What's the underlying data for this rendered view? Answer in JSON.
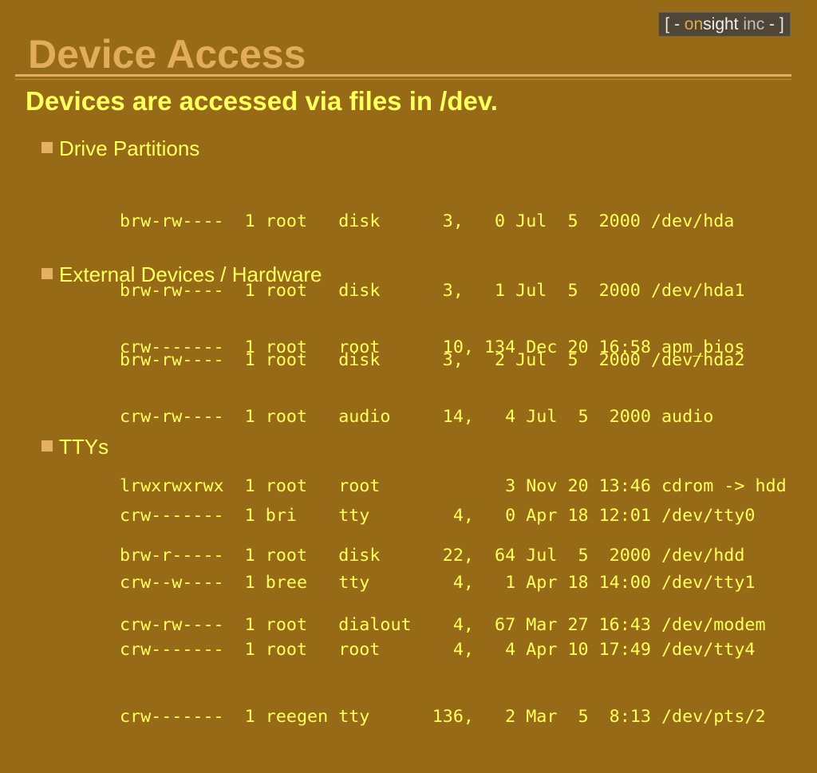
{
  "logo": {
    "open_bracket": "[ - ",
    "on": "on",
    "sight": "sight",
    "inc": " inc",
    "close_bracket": " - ]"
  },
  "slide": {
    "title": "Device Access",
    "subtitle": "Devices are accessed via files in /dev."
  },
  "sections": [
    {
      "label": "Drive Partitions",
      "lines": [
        "brw-rw----  1 root   disk      3,   0 Jul  5  2000 /dev/hda",
        "brw-rw----  1 root   disk      3,   1 Jul  5  2000 /dev/hda1",
        "brw-rw----  1 root   disk      3,   2 Jul  5  2000 /dev/hda2"
      ]
    },
    {
      "label": "External Devices / Hardware",
      "lines": [
        "crw-------  1 root   root      10, 134 Dec 20 16:58 apm_bios",
        "crw-rw----  1 root   audio     14,   4 Jul  5  2000 audio",
        "lrwxrwxrwx  1 root   root            3 Nov 20 13:46 cdrom -> hdd",
        "brw-r-----  1 root   disk      22,  64 Jul  5  2000 /dev/hdd",
        "crw-rw----  1 root   dialout    4,  67 Mar 27 16:43 /dev/modem"
      ]
    },
    {
      "label": "TTYs",
      "lines": [
        "crw-------  1 bri    tty        4,   0 Apr 18 12:01 /dev/tty0",
        "crw--w----  1 bree   tty        4,   1 Apr 18 14:00 /dev/tty1",
        "crw-------  1 root   root       4,   4 Apr 10 17:49 /dev/tty4",
        "crw-------  1 reegen tty      136,   2 Mar  5  8:13 /dev/pts/2"
      ]
    }
  ],
  "colors": {
    "background": "#966a16",
    "title": "#e2ad5b",
    "text": "#ffff5e",
    "rule": "#e3b064"
  }
}
